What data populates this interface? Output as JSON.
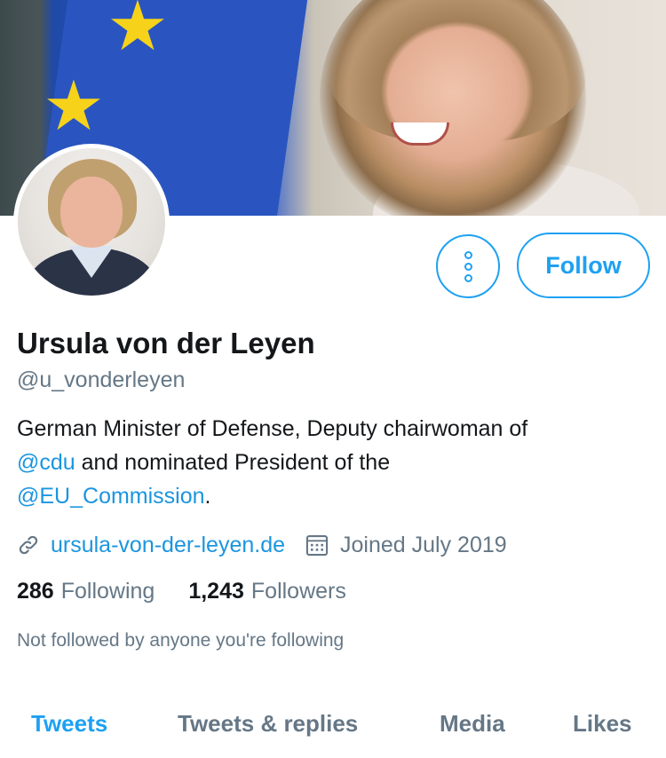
{
  "profile": {
    "name": "Ursula von der Leyen",
    "handle": "@u_vonderleyen",
    "bio": {
      "part1": "German Minister of Defense, Deputy chairwoman of",
      "mention1": "@cdu",
      "part2": " and nominated President of the",
      "mention2": "@EU_Commission",
      "part3": "."
    },
    "website": "ursula-von-der-leyen.de",
    "joined": "Joined July 2019"
  },
  "actions": {
    "more_icon": "more-vertical-icon",
    "follow_label": "Follow"
  },
  "stats": {
    "following_count": "286",
    "following_label": "Following",
    "followers_count": "1,243",
    "followers_label": "Followers"
  },
  "social_context": "Not followed by anyone you're following",
  "tabs": [
    {
      "label": "Tweets",
      "active": true
    },
    {
      "label": "Tweets & replies",
      "active": false
    },
    {
      "label": "Media",
      "active": false
    },
    {
      "label": "Likes",
      "active": false
    }
  ],
  "colors": {
    "accent": "#1da1f2",
    "link": "#1b95e0",
    "secondary_text": "#657786",
    "primary_text": "#14171a"
  }
}
